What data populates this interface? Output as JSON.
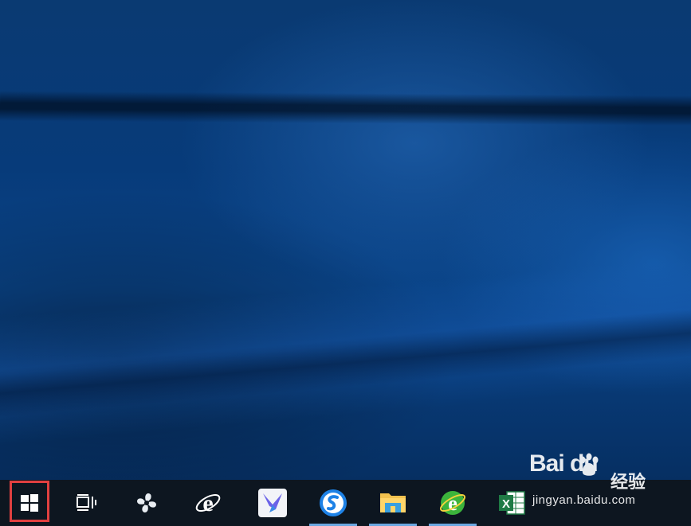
{
  "desktop": {
    "wallpaper": "Windows 10 hero wallpaper"
  },
  "taskbar": {
    "items": [
      {
        "name": "start-button",
        "icon": "windows-logo-icon"
      },
      {
        "name": "task-view",
        "icon": "task-view-icon"
      },
      {
        "name": "app-fan",
        "icon": "pinwheel-icon"
      },
      {
        "name": "internet-explorer",
        "icon": "ie-icon"
      },
      {
        "name": "app-feiyu",
        "icon": "bird-icon"
      },
      {
        "name": "sogou",
        "icon": "sogou-icon"
      },
      {
        "name": "file-explorer",
        "icon": "folder-icon"
      },
      {
        "name": "360-browser",
        "icon": "green-e-icon"
      },
      {
        "name": "excel",
        "icon": "excel-icon"
      }
    ]
  },
  "watermark": {
    "logo": "Bai du",
    "text": "经验",
    "url": "jingyan.baidu.com"
  },
  "colors": {
    "taskbar": "#0d1620",
    "highlight": "#e04040",
    "active": "#6aa7e0"
  }
}
